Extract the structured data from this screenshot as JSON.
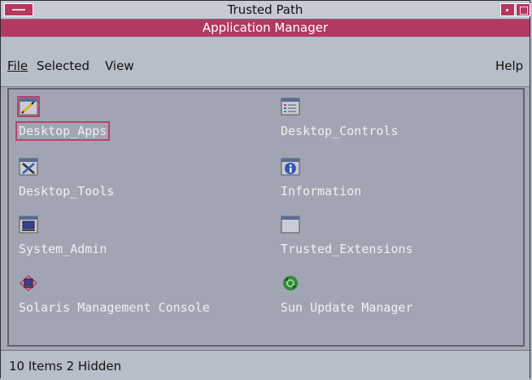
{
  "window": {
    "title": "Trusted Path",
    "app_title": "Application Manager"
  },
  "menubar": {
    "file": "File",
    "selected": "Selected",
    "view": "View",
    "help": "Help"
  },
  "items": [
    {
      "label": "Desktop_Apps",
      "icon": "editor-icon",
      "selected": true
    },
    {
      "label": "Desktop_Controls",
      "icon": "controls-folder-icon",
      "selected": false
    },
    {
      "label": "Desktop_Tools",
      "icon": "tools-icon",
      "selected": false
    },
    {
      "label": "Information",
      "icon": "info-icon",
      "selected": false
    },
    {
      "label": "System_Admin",
      "icon": "computer-icon",
      "selected": false
    },
    {
      "label": "Trusted_Extensions",
      "icon": "folder-icon",
      "selected": false
    },
    {
      "label": "Solaris Management Console",
      "icon": "management-console-icon",
      "selected": false
    },
    {
      "label": "Sun Update Manager",
      "icon": "update-icon",
      "selected": false
    }
  ],
  "status": {
    "text": "10 Items 2 Hidden"
  },
  "colors": {
    "accent": "#b23a62",
    "content_bg": "#a1a5b3",
    "chrome_bg": "#b7bdc9"
  }
}
